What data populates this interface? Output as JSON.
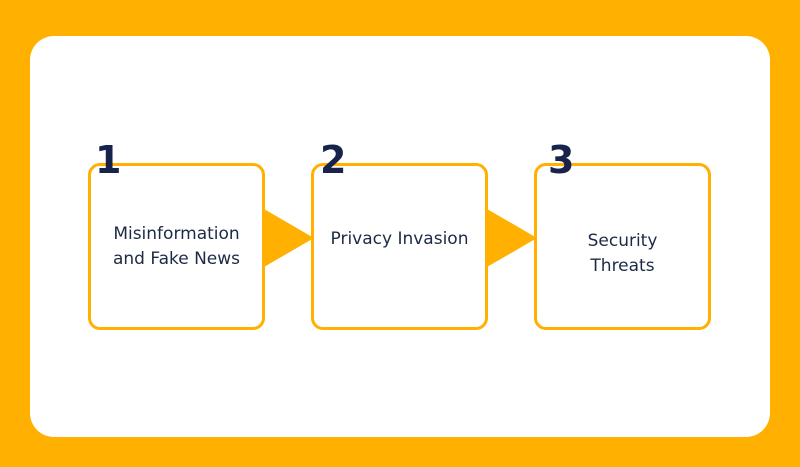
{
  "steps": [
    {
      "number": "1",
      "label_lines": [
        "Misinformation",
        "and Fake News"
      ]
    },
    {
      "number": "2",
      "label_lines": [
        "Privacy Invasion"
      ]
    },
    {
      "number": "3",
      "label_lines": [
        "Security",
        "Threats"
      ]
    }
  ],
  "colors": {
    "background": "#FFB000",
    "card": "#FFFFFF",
    "accent": "#FFB000",
    "number_text": "#17234A",
    "label_text": "#1C2A44"
  }
}
